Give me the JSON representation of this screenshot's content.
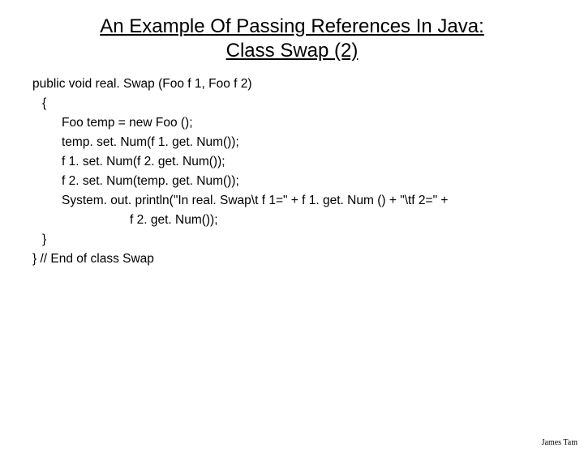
{
  "title_line1": "An Example Of Passing References In Java:",
  "title_line2": "Class Swap (2)",
  "code": {
    "sig": "public void real. Swap (Foo f 1, Foo f 2)",
    "open": "{",
    "l1": "Foo temp = new Foo ();",
    "l2": "temp. set. Num(f 1. get. Num());",
    "l3": "f 1. set. Num(f 2. get. Num());",
    "l4": "f 2. set. Num(temp. get. Num());",
    "l5a": "System. out. println(\"In real. Swap\\t f 1=\" + f 1. get. Num () + \"\\tf 2=\" +",
    "l5b": "f 2. get. Num());",
    "close_inner": "}",
    "close_outer": "}  // End of class Swap"
  },
  "footer": "James Tam"
}
